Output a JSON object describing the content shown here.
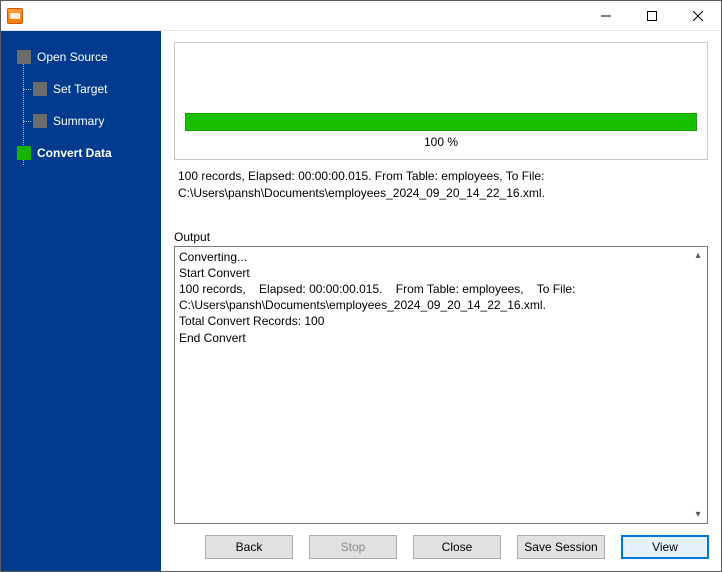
{
  "window": {
    "title": ""
  },
  "sidebar": {
    "steps": [
      {
        "label": "Open Source",
        "active": false
      },
      {
        "label": "Set Target",
        "active": false
      },
      {
        "label": "Summary",
        "active": false
      },
      {
        "label": "Convert Data",
        "active": true
      }
    ]
  },
  "progress": {
    "percent_text": "100 %",
    "fill_percent": 100
  },
  "summary": {
    "line1": "100 records,    Elapsed: 00:00:00.015.    From Table: employees,    To File:",
    "line2": "C:\\Users\\pansh\\Documents\\employees_2024_09_20_14_22_16.xml."
  },
  "output": {
    "label": "Output",
    "lines": [
      "Converting...",
      "Start Convert",
      "100 records,    Elapsed: 00:00:00.015.    From Table: employees,    To File: C:\\Users\\pansh\\Documents\\employees_2024_09_20_14_22_16.xml.",
      "Total Convert Records: 100",
      "End Convert"
    ]
  },
  "buttons": {
    "back": "Back",
    "stop": "Stop",
    "close": "Close",
    "save_session": "Save Session",
    "view": "View"
  }
}
